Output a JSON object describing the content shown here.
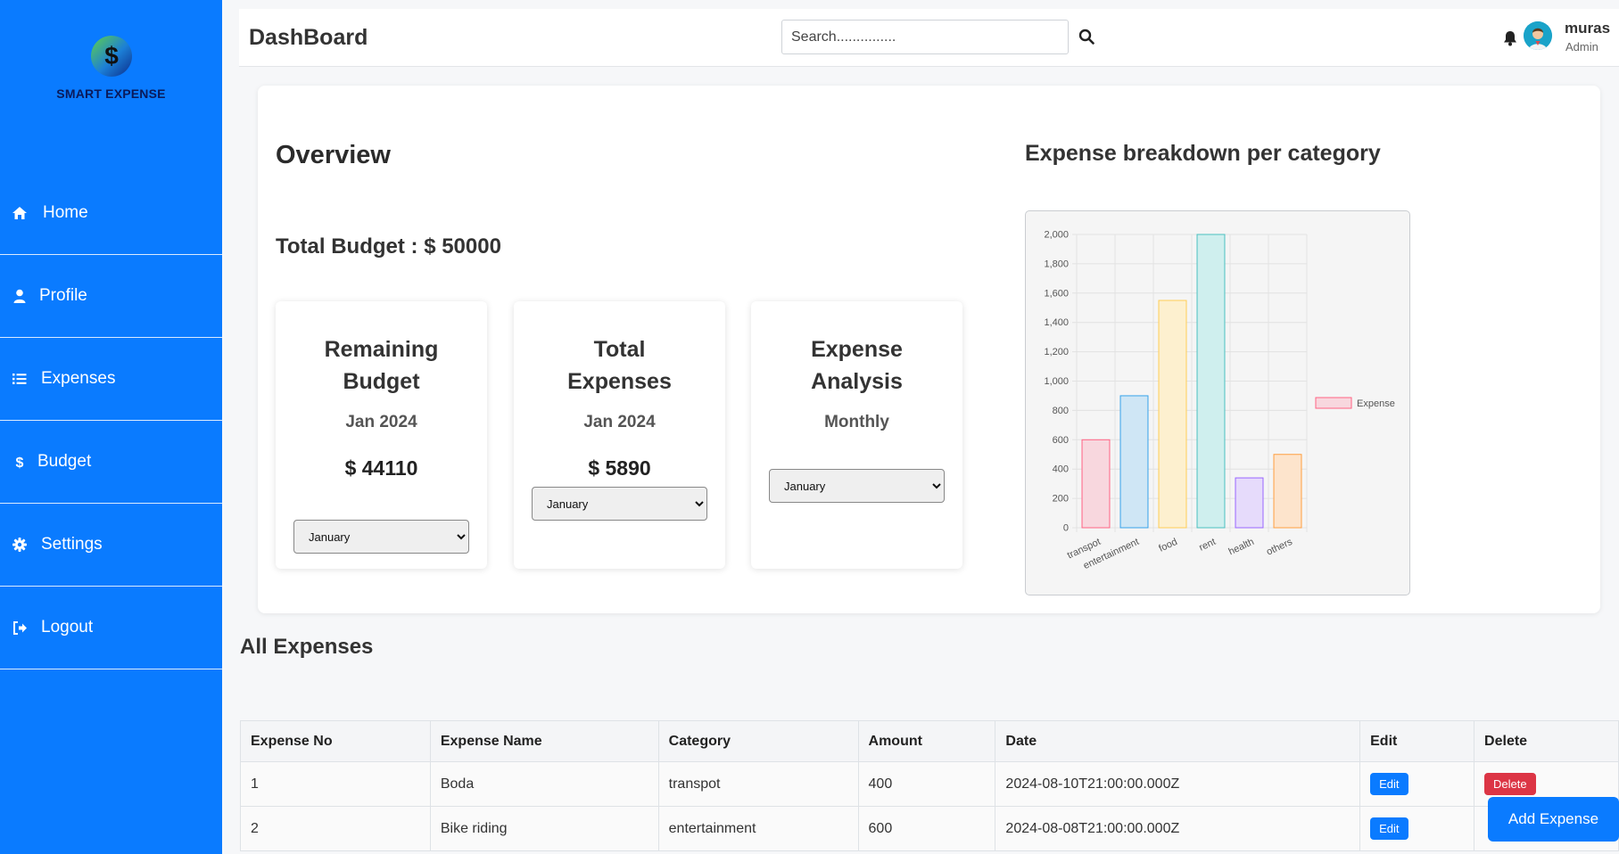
{
  "brand": {
    "logo_text": "SMART EXPENSE"
  },
  "sidebar": {
    "items": [
      {
        "label": "Home",
        "icon": "home-icon"
      },
      {
        "label": "Profile",
        "icon": "user-icon"
      },
      {
        "label": "Expenses",
        "icon": "list-icon"
      },
      {
        "label": "Budget",
        "icon": "dollar-icon"
      },
      {
        "label": "Settings",
        "icon": "gear-icon"
      },
      {
        "label": "Logout",
        "icon": "logout-icon"
      }
    ]
  },
  "header": {
    "title": "DashBoard",
    "search_placeholder": "Search...............",
    "user_name": "muras",
    "user_role": "Admin"
  },
  "overview": {
    "title": "Overview",
    "total_budget": "Total Budget : $ 50000",
    "cards": [
      {
        "title": "Remaining Budget",
        "sub": "Jan 2024",
        "value": "$ 44110",
        "select": "January"
      },
      {
        "title": "Total Expenses",
        "sub": "Jan 2024",
        "value": "$ 5890",
        "select": "January"
      },
      {
        "title": "Expense Analysis",
        "sub": "Monthly",
        "value": "",
        "select": "January"
      }
    ],
    "chart_title": "Expense breakdown per category"
  },
  "chart_data": {
    "type": "bar",
    "title": "Expense breakdown per category",
    "categories": [
      "transpot",
      "entertainment",
      "food",
      "rent",
      "health",
      "others"
    ],
    "series": [
      {
        "name": "Expense",
        "values": [
          600,
          900,
          1550,
          2000,
          340,
          500
        ]
      }
    ],
    "colors": {
      "fills": [
        "#f8d7de",
        "#cfe6f5",
        "#fdf0cf",
        "#cfefee",
        "#e6dbfb",
        "#fde4cc"
      ],
      "strokes": [
        "#ff6384",
        "#36a2eb",
        "#ffcd56",
        "#4bc0c0",
        "#9966ff",
        "#ff9f40"
      ]
    },
    "yticks": [
      "0",
      "200",
      "400",
      "600",
      "800",
      "1,000",
      "1,200",
      "1,400",
      "1,600",
      "1,800",
      "2,000"
    ],
    "ylim": [
      0,
      2000
    ],
    "grid": true,
    "legend": "right"
  },
  "expenses": {
    "title": "All Expenses",
    "columns": [
      "Expense No",
      "Expense Name",
      "Category",
      "Amount",
      "Date",
      "Edit",
      "Delete"
    ],
    "rows": [
      {
        "no": "1",
        "name": "Boda",
        "category": "transpot",
        "amount": "400",
        "date": "2024-08-10T21:00:00.000Z"
      },
      {
        "no": "2",
        "name": "Bike riding",
        "category": "entertainment",
        "amount": "600",
        "date": "2024-08-08T21:00:00.000Z"
      }
    ],
    "edit_label": "Edit",
    "delete_label": "Delete",
    "add_label": "Add Expense"
  }
}
